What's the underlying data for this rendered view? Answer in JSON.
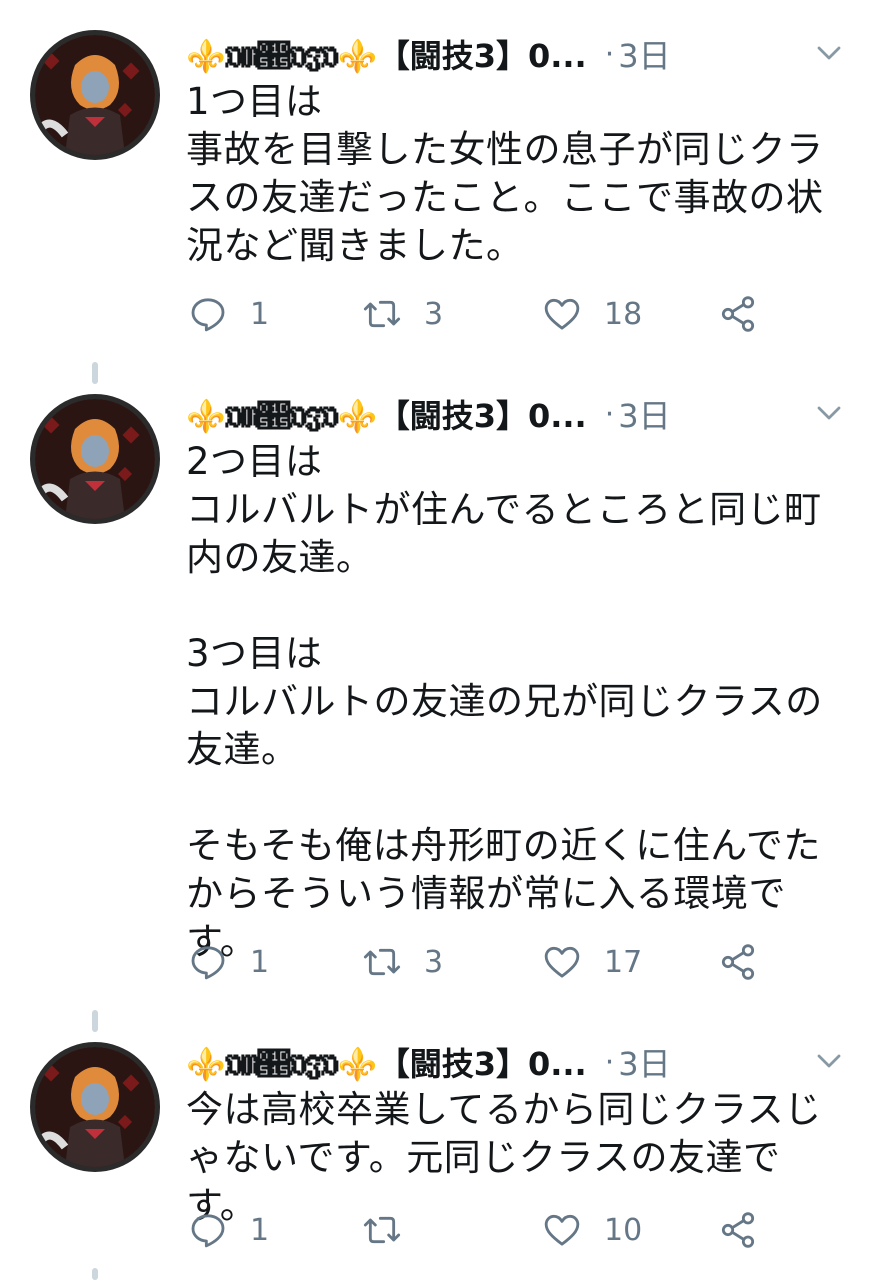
{
  "tweets": [
    {
      "author": "⚜️𝔒𝔐𝔕𝔒𝔍𝔒⚜️【闘技3】0...",
      "time_sep": "·",
      "time": "3日",
      "text": "1つ目は\n事故を目撃した女性の息子が同じクラスの友達だったこと。ここで事故の状況など聞きました。",
      "replies": "1",
      "retweets": "3",
      "likes": "18"
    },
    {
      "author": "⚜️𝔒𝔐𝔕𝔒𝔍𝔒⚜️【闘技3】0...",
      "time_sep": "·",
      "time": "3日",
      "text": "2つ目は\nコルバルトが住んでるところと同じ町内の友達。\n\n3つ目は\nコルバルトの友達の兄が同じクラスの友達。\n\nそもそも俺は舟形町の近くに住んでたからそういう情報が常に入る環境です。",
      "replies": "1",
      "retweets": "3",
      "likes": "17"
    },
    {
      "author": "⚜️𝔒𝔐𝔕𝔒𝔍𝔒⚜️【闘技3】0...",
      "time_sep": "·",
      "time": "3日",
      "text": "今は高校卒業してるから同じクラスじゃないです。元同じクラスの友達です。",
      "replies": "1",
      "retweets": "",
      "likes": "10"
    }
  ],
  "icons": {
    "reply": "reply-icon",
    "retweet": "retweet-icon",
    "like": "heart-icon",
    "share": "share-icon",
    "menu": "chevron-down-icon"
  },
  "colors": {
    "text": "#14171a",
    "secondary": "#657786",
    "thread_line": "#ccd6dd",
    "fleur": "#e0a12a"
  }
}
